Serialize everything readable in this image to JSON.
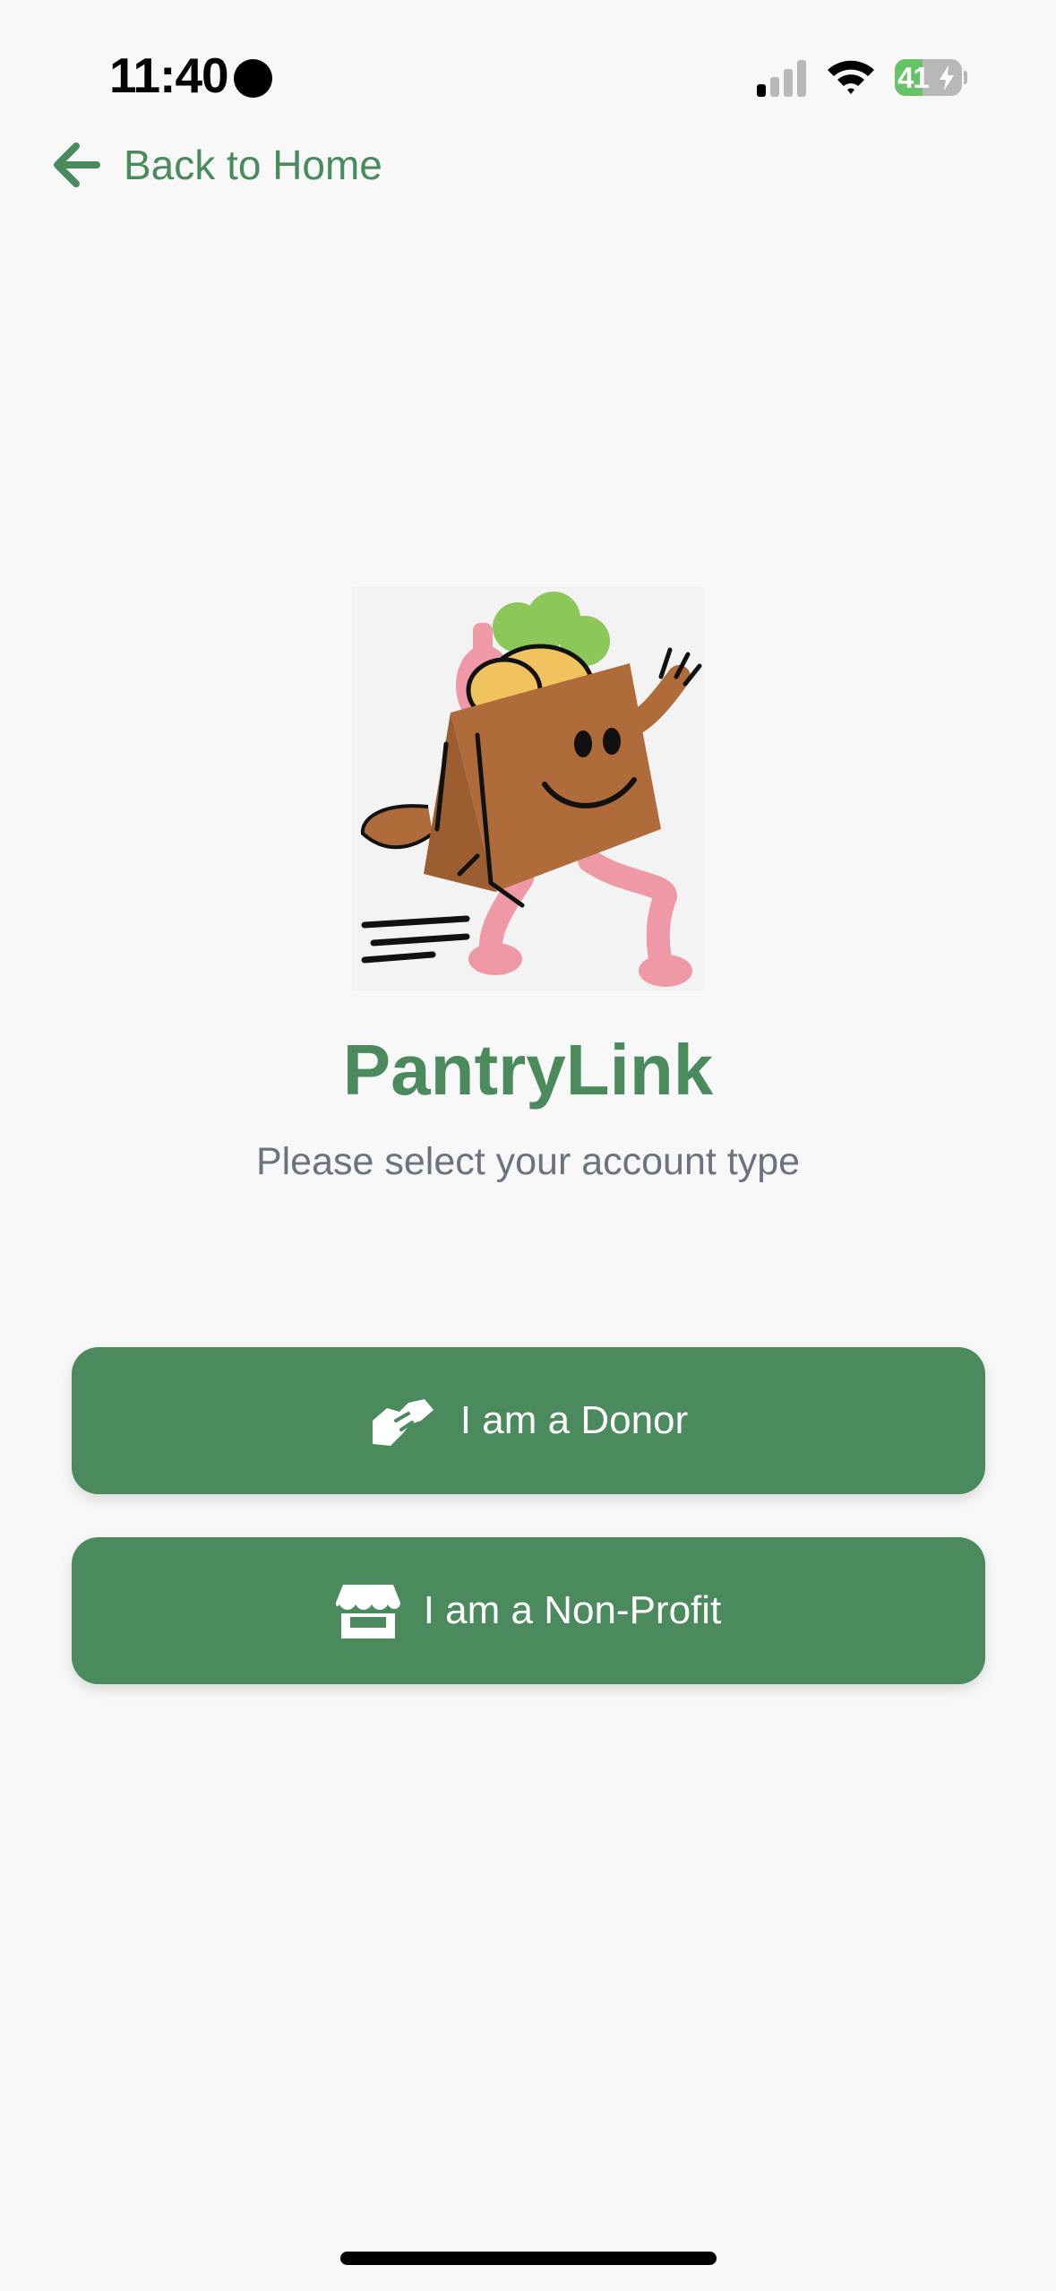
{
  "status_bar": {
    "time": "11:40",
    "battery_level": "41",
    "battery_fraction": 0.41,
    "signal_bars_active": 1,
    "signal_bars_total": 4,
    "icons": [
      "recording-dot",
      "signal-icon",
      "wifi-icon",
      "battery-icon",
      "charging-bolt-icon"
    ]
  },
  "nav": {
    "back_label": "Back to Home",
    "back_icon": "arrow-left-icon"
  },
  "hero": {
    "title": "PantryLink",
    "subtitle": "Please select your account type",
    "mascot": "grocery-bag-mascot"
  },
  "actions": {
    "donor_label": "I am a Donor",
    "donor_icon": "handshake-icon",
    "nonprofit_label": "I am a Non-Profit",
    "nonprofit_icon": "storefront-icon"
  },
  "colors": {
    "brand_green": "#4a8a5d",
    "background": "#f7f8f7",
    "subtitle_gray": "#6b7280",
    "battery_green": "#65c466"
  }
}
